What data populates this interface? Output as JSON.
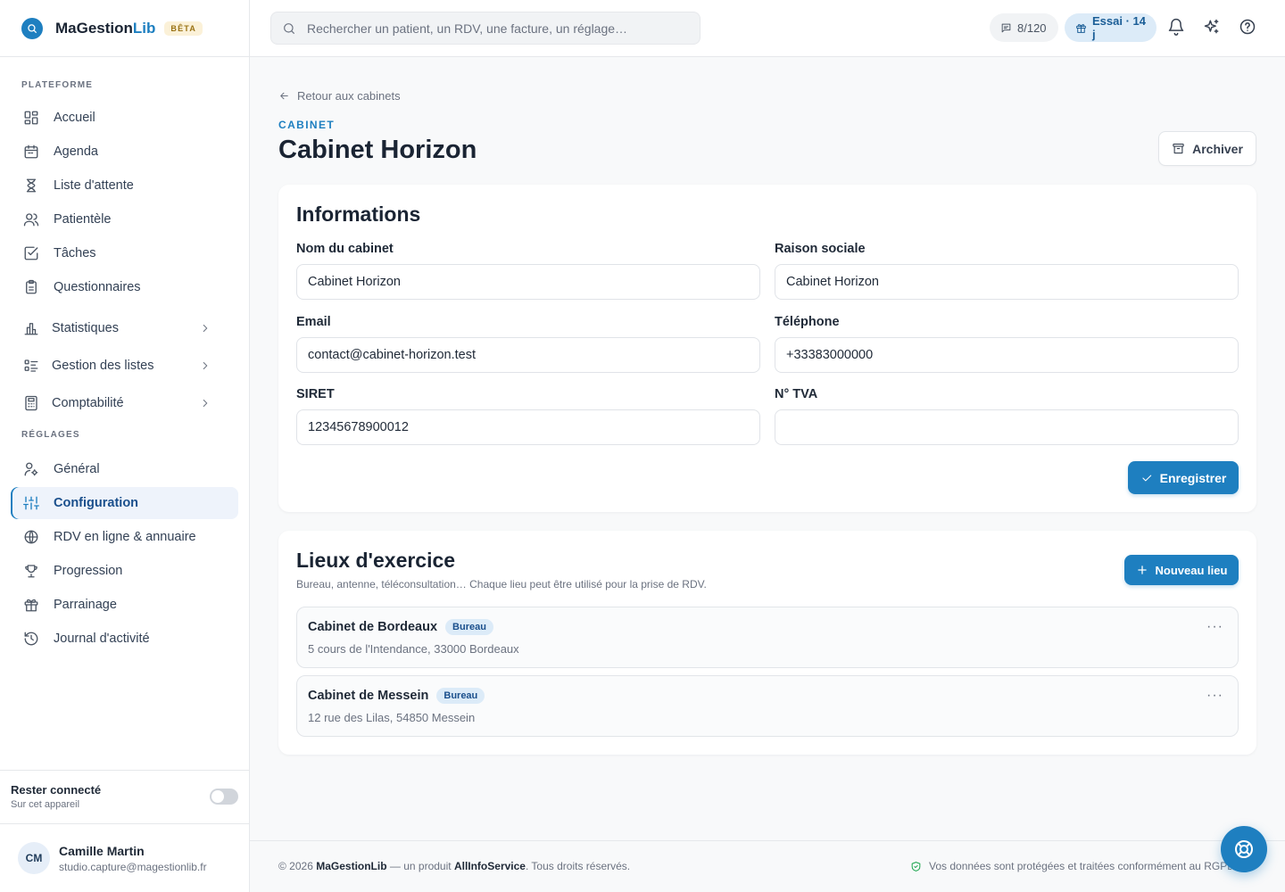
{
  "brand": {
    "name_main": "MaGestion",
    "name_accent": "Lib",
    "badge": "BÊTA"
  },
  "sidebar": {
    "section_platform": "PLATEFORME",
    "section_settings": "RÉGLAGES",
    "platform_items": [
      {
        "label": "Accueil",
        "icon": "dashboard-icon"
      },
      {
        "label": "Agenda",
        "icon": "calendar-icon"
      },
      {
        "label": "Liste d'attente",
        "icon": "hourglass-icon"
      },
      {
        "label": "Patientèle",
        "icon": "users-icon"
      },
      {
        "label": "Tâches",
        "icon": "check-square-icon"
      },
      {
        "label": "Questionnaires",
        "icon": "clipboard-icon"
      }
    ],
    "group_items": [
      {
        "label": "Statistiques",
        "icon": "bar-chart-icon"
      },
      {
        "label": "Gestion des listes",
        "icon": "list-icon"
      },
      {
        "label": "Comptabilité",
        "icon": "calculator-icon"
      }
    ],
    "settings_items": [
      {
        "label": "Général",
        "icon": "user-cog-icon"
      },
      {
        "label": "Configuration",
        "icon": "sliders-icon",
        "active": true
      },
      {
        "label": "RDV en ligne & annuaire",
        "icon": "globe-icon"
      },
      {
        "label": "Progression",
        "icon": "trophy-icon"
      },
      {
        "label": "Parrainage",
        "icon": "gift-icon"
      },
      {
        "label": "Journal d'activité",
        "icon": "history-icon"
      }
    ],
    "stay_connected": {
      "title": "Rester connecté",
      "subtitle": "Sur cet appareil",
      "enabled": false
    },
    "user": {
      "initials": "CM",
      "name": "Camille Martin",
      "email": "studio.capture@magestionlib.fr"
    }
  },
  "topbar": {
    "search_placeholder": "Rechercher un patient, un RDV, une facture, un réglage…",
    "sms_count": "8/120",
    "trial": "Essai · 14 j"
  },
  "page": {
    "back_label": "Retour aux cabinets",
    "eyebrow": "CABINET",
    "title": "Cabinet Horizon",
    "archive_label": "Archiver"
  },
  "info": {
    "title": "Informations",
    "fields": {
      "nom": {
        "label": "Nom du cabinet",
        "value": "Cabinet Horizon"
      },
      "raison": {
        "label": "Raison sociale",
        "value": "Cabinet Horizon"
      },
      "email": {
        "label": "Email",
        "value": "contact@cabinet-horizon.test"
      },
      "tel": {
        "label": "Téléphone",
        "value": "+33383000000"
      },
      "siret": {
        "label": "SIRET",
        "value": "12345678900012"
      },
      "tva": {
        "label": "N° TVA",
        "value": ""
      }
    },
    "save_label": "Enregistrer"
  },
  "places": {
    "title": "Lieux d'exercice",
    "subtitle": "Bureau, antenne, téléconsultation… Chaque lieu peut être utilisé pour la prise de RDV.",
    "new_label": "Nouveau lieu",
    "items": [
      {
        "name": "Cabinet de Bordeaux",
        "tag": "Bureau",
        "address": "5 cours de l'Intendance, 33000 Bordeaux"
      },
      {
        "name": "Cabinet de Messein",
        "tag": "Bureau",
        "address": "12 rue des Lilas, 54850 Messein"
      }
    ],
    "more": "···"
  },
  "footer": {
    "copyright": "© 2026",
    "brand": "MaGestionLib",
    "middle": " — un produit ",
    "company": "AllInfoService",
    "rights": ". Tous droits réservés.",
    "privacy": "Vos données sont protégées et traitées conformément au RGPD."
  },
  "colors": {
    "accent": "#1e7fc0",
    "active_bg": "#eef3fb",
    "beta_bg": "#fbf1d8"
  }
}
